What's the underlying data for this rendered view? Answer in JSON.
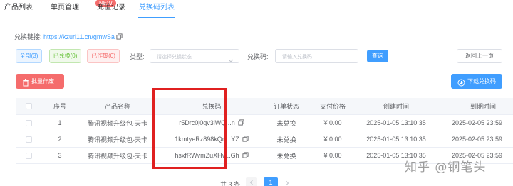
{
  "tabs": {
    "items": [
      {
        "label": "产品列表"
      },
      {
        "label": "单页管理"
      },
      {
        "label": "充值记录"
      },
      {
        "label": "兑换码列表"
      }
    ],
    "new_badge": "NEW"
  },
  "link": {
    "label": "兑换链接:",
    "url": "https://kzuri11.cn/gmwSa"
  },
  "filters": {
    "chips": {
      "all": "全部(3)",
      "used": "已兑换(0)",
      "void": "已作废(0)"
    },
    "type_label": "类型:",
    "type_placeholder": "请选择兑换状态",
    "code_label": "兑换码:",
    "code_placeholder": "请输入兑换码",
    "query_label": "查询",
    "back_label": "返回上一页"
  },
  "actions": {
    "void_batch": "批量作废",
    "download": "下载兑换码"
  },
  "table": {
    "headers": {
      "index": "序号",
      "product": "产品名称",
      "code": "兑换码",
      "status": "订单状态",
      "price": "支付价格",
      "created": "创建时间",
      "expire": "到期时间"
    },
    "rows": [
      {
        "index": "1",
        "product": "腾讯视频升级包-天卡",
        "code": "r5Drc0j0qv3iWQ...n",
        "status": "未兑换",
        "price": "¥ 0.00",
        "created": "2025-01-05 13:10:35",
        "expire": "2025-02-05 23:59"
      },
      {
        "index": "2",
        "product": "腾讯视频升级包-天卡",
        "code": "1kmtyeRz898kQm..YZ",
        "status": "未兑换",
        "price": "¥ 0.00",
        "created": "2025-01-05 13:10:35",
        "expire": "2025-02-05 23:59"
      },
      {
        "index": "3",
        "product": "腾讯视频升级包-天卡",
        "code": "hsxfRWvmZuXHvr..Gh",
        "status": "未兑换",
        "price": "¥ 0.00",
        "created": "2025-01-05 13:10:35",
        "expire": "2025-02-05 23:59"
      }
    ]
  },
  "pagination": {
    "total": "共 3 条",
    "current_page": "1"
  },
  "watermark": "知乎 @钢笔头",
  "colors": {
    "primary": "#409eff",
    "danger": "#f56c6c",
    "success": "#67c23a",
    "highlight": "#e02020"
  }
}
